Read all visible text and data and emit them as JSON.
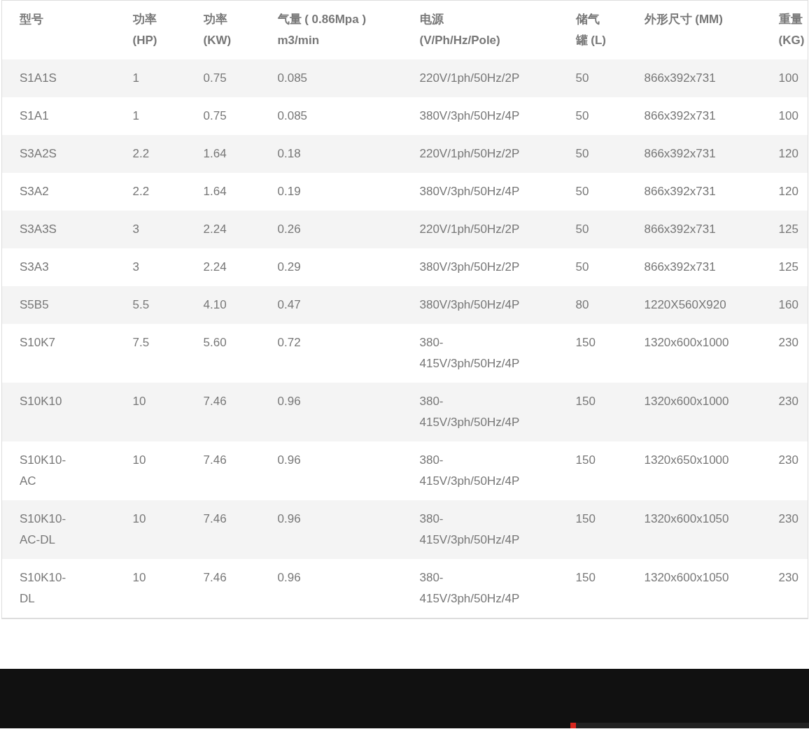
{
  "table": {
    "columns": [
      "型号",
      "功率\n(HP)",
      "功率\n(KW)",
      "气量 ( 0.86Mpa )\nm3/min",
      "电源\n(V/Ph/Hz/Pole)",
      "储气罐 (L)",
      "外形尺寸 (MM)",
      "重量\n(KG)"
    ],
    "rows": [
      [
        "S1A1S",
        "1",
        "0.75",
        "0.085",
        "220V/1ph/50Hz/2P",
        "50",
        "866x392x731",
        "100"
      ],
      [
        "S1A1",
        "1",
        "0.75",
        "0.085",
        "380V/3ph/50Hz/4P",
        "50",
        "866x392x731",
        "100"
      ],
      [
        "S3A2S",
        "2.2",
        "1.64",
        "0.18",
        "220V/1ph/50Hz/2P",
        "50",
        "866x392x731",
        "120"
      ],
      [
        "S3A2",
        "2.2",
        "1.64",
        "0.19",
        "380V/3ph/50Hz/4P",
        "50",
        "866x392x731",
        "120"
      ],
      [
        "S3A3S",
        "3",
        "2.24",
        "0.26",
        "220V/1ph/50Hz/2P",
        "50",
        "866x392x731",
        "125"
      ],
      [
        "S3A3",
        "3",
        "2.24",
        "0.29",
        "380V/3ph/50Hz/2P",
        "50",
        "866x392x731",
        "125"
      ],
      [
        "S5B5",
        "5.5",
        "4.10",
        "0.47",
        "380V/3ph/50Hz/4P",
        "80",
        "1220X560X920",
        "160"
      ],
      [
        "S10K7",
        "7.5",
        "5.60",
        "0.72",
        "380-415V/3ph/50Hz/4P",
        "150",
        "1320x600x1000",
        "230"
      ],
      [
        "S10K10",
        "10",
        "7.46",
        "0.96",
        "380-415V/3ph/50Hz/4P",
        "150",
        "1320x600x1000",
        "230"
      ],
      [
        "S10K10-AC",
        "10",
        "7.46",
        "0.96",
        "380-415V/3ph/50Hz/4P",
        "150",
        "1320x650x1000",
        "230"
      ],
      [
        "S10K10-AC-DL",
        "10",
        "7.46",
        "0.96",
        "380-415V/3ph/50Hz/4P",
        "150",
        "1320x600x1050",
        "230"
      ],
      [
        "S10K10-DL",
        "10",
        "7.46",
        "0.96",
        "380-415V/3ph/50Hz/4P",
        "150",
        "1320x600x1050",
        "230"
      ]
    ]
  }
}
